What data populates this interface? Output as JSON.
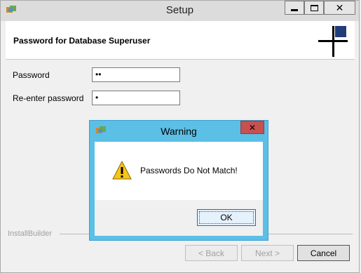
{
  "window": {
    "title": "Setup",
    "controls": {
      "minimize": "minimize",
      "maximize": "maximize",
      "close": "✕"
    }
  },
  "header": {
    "title": "Password for Database Superuser"
  },
  "form": {
    "password": {
      "label": "Password",
      "value": "••"
    },
    "reenter": {
      "label": "Re-enter password",
      "value": "•"
    }
  },
  "footer": {
    "brand": "InstallBuilder",
    "back": "< Back",
    "next": "Next >",
    "cancel": "Cancel"
  },
  "dialog": {
    "title": "Warning",
    "close": "✕",
    "message": "Passwords Do Not Match!",
    "ok": "OK"
  },
  "colors": {
    "dialog_frame": "#5bbfe6",
    "close_red": "#c75050",
    "logo_blue": "#1f3d7a",
    "focus_blue": "#0078d7",
    "warning_yellow": "#f5c518"
  }
}
